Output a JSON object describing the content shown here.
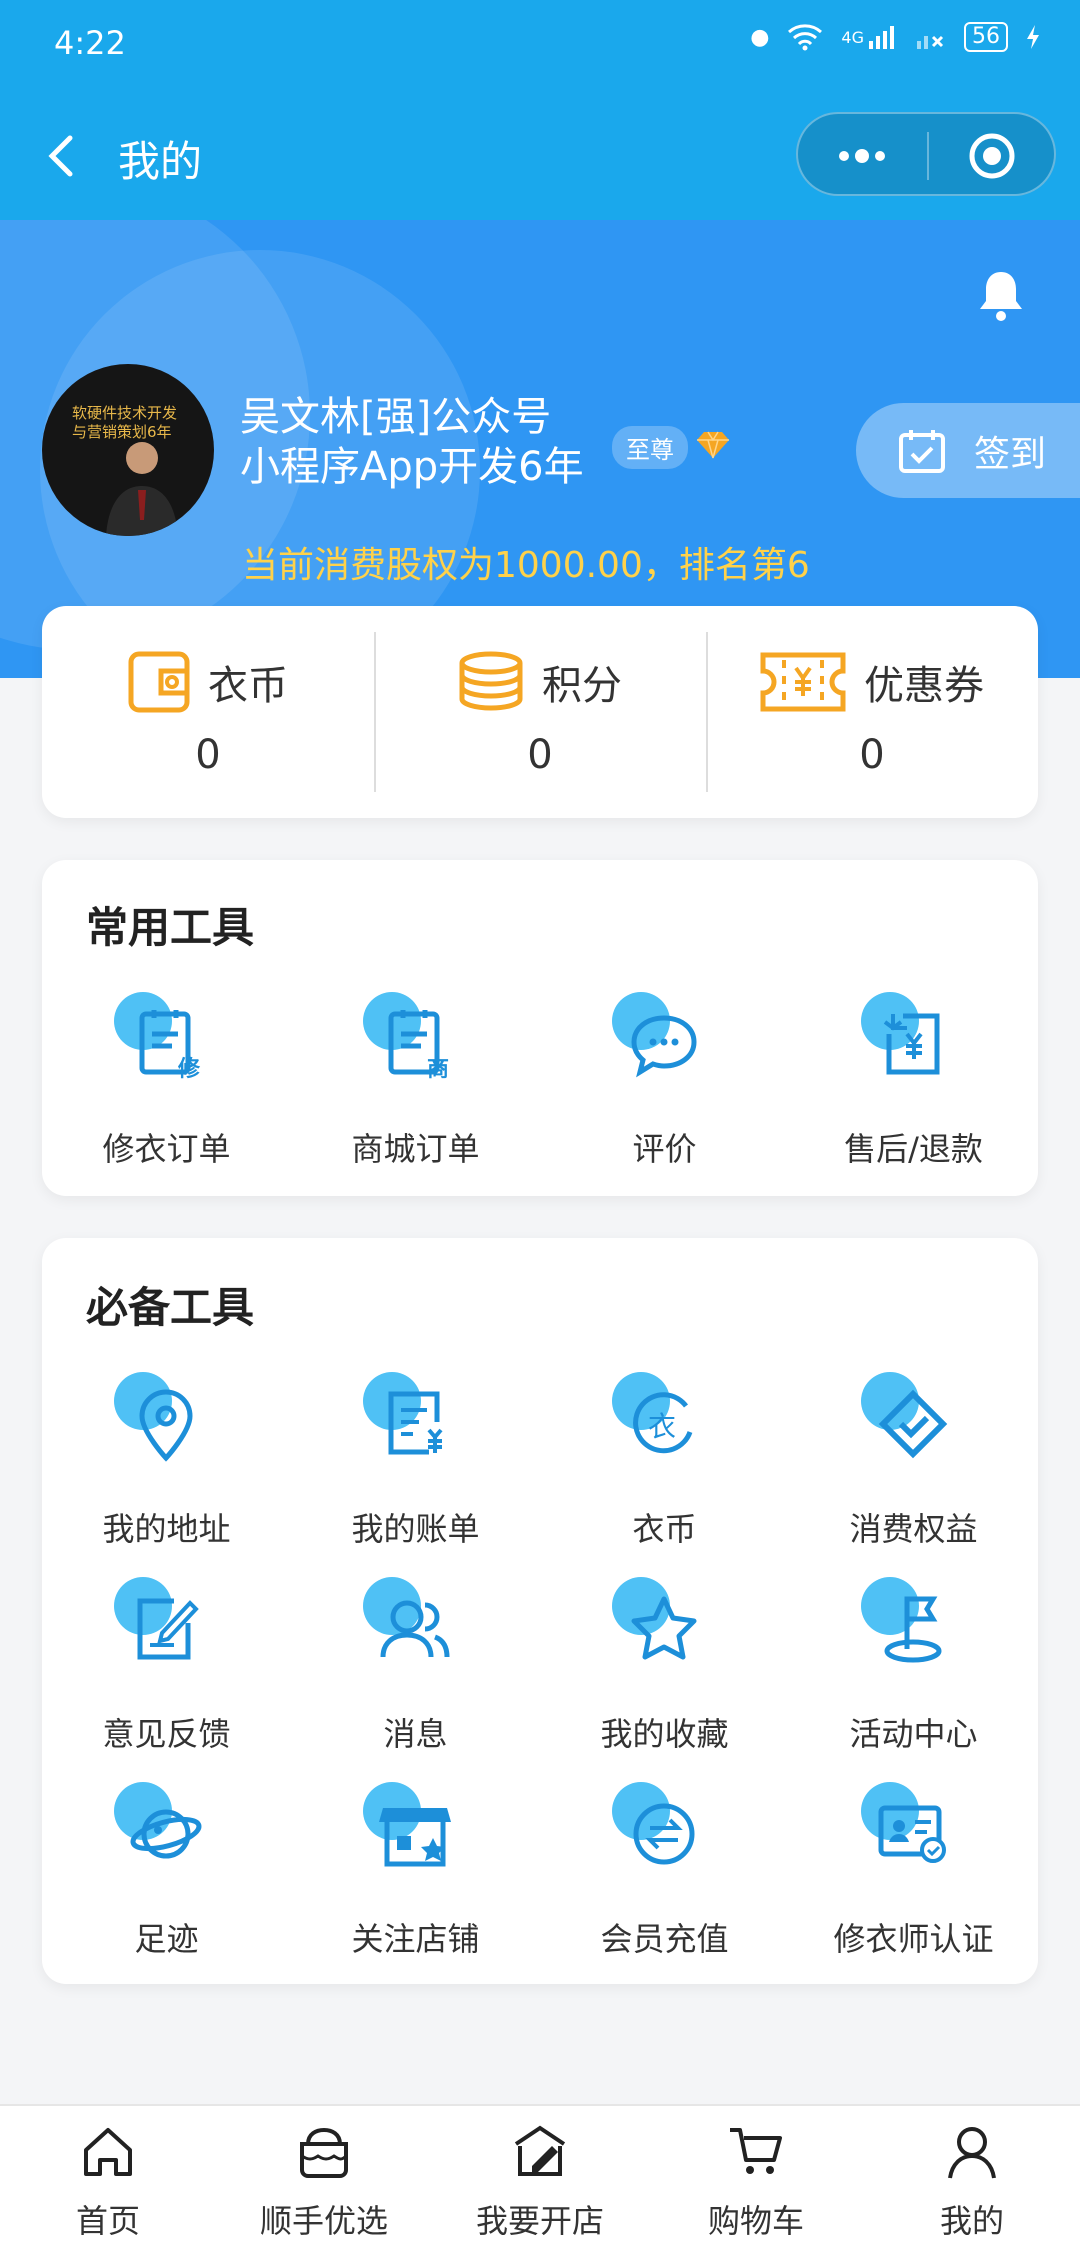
{
  "status": {
    "time": "4:22",
    "net": "4G",
    "battery": "56"
  },
  "nav": {
    "title": "我的"
  },
  "profile": {
    "name_line1": "吴文林[强]公众号",
    "name_line2": "小程序App开发6年",
    "tag": "至尊",
    "equity_text": "当前消费股权为1000.00，排名第6",
    "checkin_label": "签到",
    "avatar_text_1": "软硬件技术开发",
    "avatar_text_2": "与营销策划6年"
  },
  "stats": [
    {
      "label": "衣币",
      "value": "0",
      "icon": "wallet-icon"
    },
    {
      "label": "积分",
      "value": "0",
      "icon": "coins-icon"
    },
    {
      "label": "优惠券",
      "value": "0",
      "icon": "coupon-icon"
    }
  ],
  "common_tools": {
    "title": "常用工具",
    "items": [
      {
        "label": "修衣订单",
        "icon": "repair-order-icon"
      },
      {
        "label": "商城订单",
        "icon": "shop-order-icon"
      },
      {
        "label": "评价",
        "icon": "comment-icon"
      },
      {
        "label": "售后/退款",
        "icon": "refund-icon"
      }
    ]
  },
  "essential_tools": {
    "title": "必备工具",
    "items": [
      {
        "label": "我的地址",
        "icon": "location-icon"
      },
      {
        "label": "我的账单",
        "icon": "bill-icon"
      },
      {
        "label": "衣币",
        "icon": "clothes-coin-icon"
      },
      {
        "label": "消费权益",
        "icon": "rights-icon"
      },
      {
        "label": "意见反馈",
        "icon": "feedback-icon"
      },
      {
        "label": "消息",
        "icon": "message-icon"
      },
      {
        "label": "我的收藏",
        "icon": "star-icon"
      },
      {
        "label": "活动中心",
        "icon": "flag-icon"
      },
      {
        "label": "足迹",
        "icon": "planet-icon"
      },
      {
        "label": "关注店铺",
        "icon": "store-icon"
      },
      {
        "label": "会员充值",
        "icon": "exchange-icon"
      },
      {
        "label": "修衣师认证",
        "icon": "certificate-icon"
      }
    ]
  },
  "tabbar": [
    {
      "label": "首页",
      "icon": "home-icon"
    },
    {
      "label": "顺手优选",
      "icon": "basket-icon"
    },
    {
      "label": "我要开店",
      "icon": "open-store-icon"
    },
    {
      "label": "购物车",
      "icon": "cart-icon"
    },
    {
      "label": "我的",
      "icon": "user-icon"
    }
  ],
  "colors": {
    "primary": "#1aa8ec",
    "header": "#2f96f3",
    "accent": "#f5a623",
    "icon_blue": "#1d8fd9",
    "dot": "#4fc1f5"
  }
}
